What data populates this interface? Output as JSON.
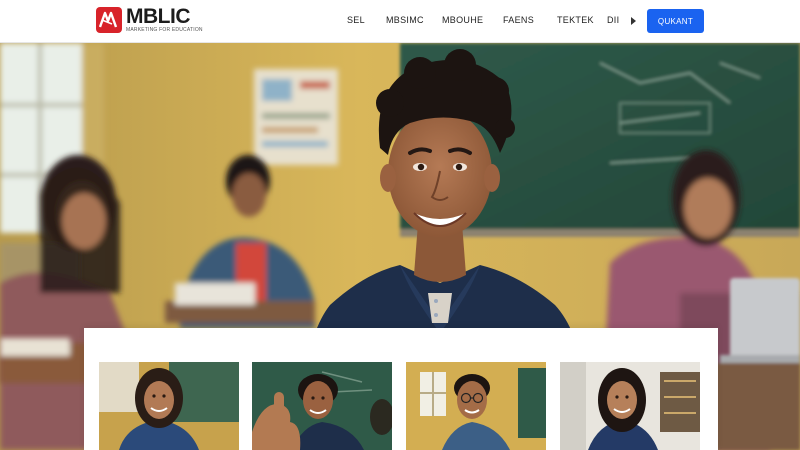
{
  "brand": {
    "name": "MBLIC",
    "tagline": "MARKETING FOR EDUCATION",
    "accent_color": "#d8232a"
  },
  "nav": {
    "items": [
      {
        "label": "SEL"
      },
      {
        "label": "MBSIMC"
      },
      {
        "label": "MBOUHE"
      },
      {
        "label": "FAENS"
      },
      {
        "label": "TEKTEK"
      },
      {
        "label": "DII"
      }
    ],
    "more_icon": "play-arrow-icon",
    "cta_label": "QUKANT",
    "cta_color": "#1a63f0"
  },
  "hero": {
    "image": "smiling student in classroom with classmates at desks and a chalkboard"
  },
  "gallery": {
    "items": [
      {
        "image": "student with long hair smiling in classroom"
      },
      {
        "image": "student giving thumbs up near chalkboard"
      },
      {
        "image": "student with glasses smiling in classroom"
      },
      {
        "image": "student with long hair smiling near shelves"
      }
    ]
  }
}
